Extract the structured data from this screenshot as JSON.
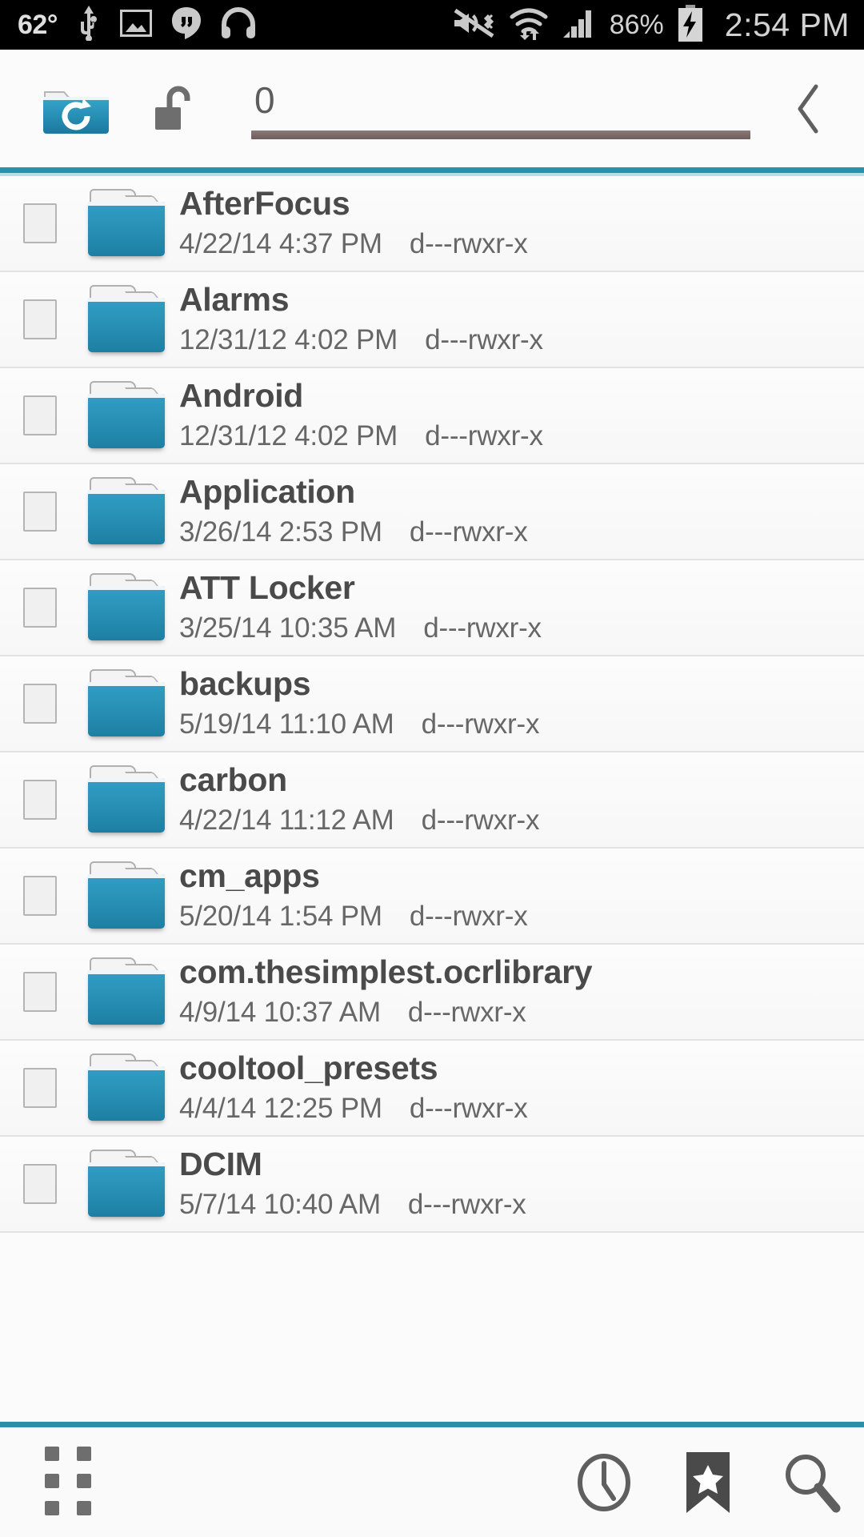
{
  "statusbar": {
    "temperature": "62°",
    "battery_percent": "86%",
    "clock": "2:54 PM",
    "icons_left": [
      "usb-icon",
      "photo-icon",
      "hangouts-icon",
      "headphones-icon"
    ],
    "icons_right": [
      "vibrate-off-icon",
      "wifi-icon",
      "signal-bars-icon",
      "battery-charging-icon"
    ],
    "background": "#000000",
    "foreground": "#c9c9c9"
  },
  "toolbar": {
    "refresh_folder_icon": "folder-refresh-icon",
    "lock_icon": "unlocked-padlock-icon",
    "path_value": "0",
    "path_placeholder": "0",
    "back_icon": "chevron-left-icon",
    "underline_color": "#7a6a68",
    "divider_color": "#2a8fa8"
  },
  "filelist": {
    "columns": [
      "checkbox",
      "icon",
      "name",
      "date",
      "permissions"
    ],
    "rows": [
      {
        "name": "AfterFocus",
        "date": "4/22/14 4:37 PM",
        "perm": "d---rwxr-x",
        "icon": "folder-icon",
        "checked": false
      },
      {
        "name": "Alarms",
        "date": "12/31/12 4:02 PM",
        "perm": "d---rwxr-x",
        "icon": "folder-icon",
        "checked": false
      },
      {
        "name": "Android",
        "date": "12/31/12 4:02 PM",
        "perm": "d---rwxr-x",
        "icon": "folder-icon",
        "checked": false
      },
      {
        "name": "Application",
        "date": "3/26/14 2:53 PM",
        "perm": "d---rwxr-x",
        "icon": "folder-icon",
        "checked": false
      },
      {
        "name": "ATT Locker",
        "date": "3/25/14 10:35 AM",
        "perm": "d---rwxr-x",
        "icon": "folder-icon",
        "checked": false
      },
      {
        "name": "backups",
        "date": "5/19/14 11:10 AM",
        "perm": "d---rwxr-x",
        "icon": "folder-icon",
        "checked": false
      },
      {
        "name": "carbon",
        "date": "4/22/14 11:12 AM",
        "perm": "d---rwxr-x",
        "icon": "folder-icon",
        "checked": false
      },
      {
        "name": "cm_apps",
        "date": "5/20/14 1:54 PM",
        "perm": "d---rwxr-x",
        "icon": "folder-icon",
        "checked": false
      },
      {
        "name": "com.thesimplest.ocrlibrary",
        "date": "4/9/14 10:37 AM",
        "perm": "d---rwxr-x",
        "icon": "folder-icon",
        "checked": false
      },
      {
        "name": "cooltool_presets",
        "date": "4/4/14 12:25 PM",
        "perm": "d---rwxr-x",
        "icon": "folder-icon",
        "checked": false
      },
      {
        "name": "DCIM",
        "date": "5/7/14 10:40 AM",
        "perm": "d---rwxr-x",
        "icon": "folder-icon",
        "checked": false
      }
    ]
  },
  "bottombar": {
    "grid_icon": "grid-dots-icon",
    "history_icon": "clock-icon",
    "bookmarks_icon": "bookmark-star-icon",
    "search_icon": "search-icon",
    "divider_color": "#2a8fa8"
  }
}
